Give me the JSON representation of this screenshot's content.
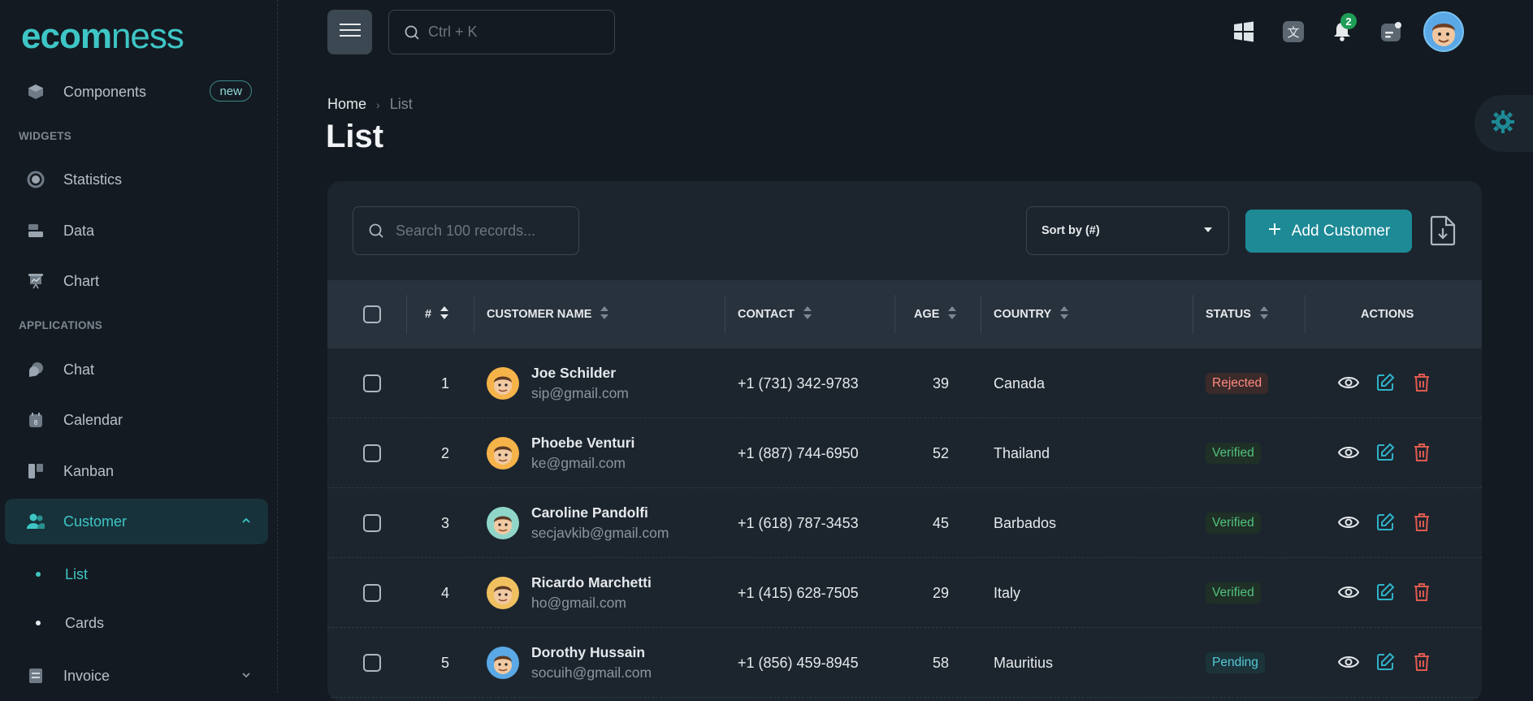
{
  "brand": {
    "logo_bold": "ecom",
    "logo_light": "ness"
  },
  "sidebar": {
    "components": {
      "label": "Components",
      "badge": "new"
    },
    "widgets_title": "WIDGETS",
    "widgets": [
      {
        "label": "Statistics",
        "icon": "statistics-icon"
      },
      {
        "label": "Data",
        "icon": "data-icon"
      },
      {
        "label": "Chart",
        "icon": "chart-icon"
      }
    ],
    "applications_title": "APPLICATIONS",
    "applications": [
      {
        "label": "Chat",
        "icon": "chat-icon"
      },
      {
        "label": "Calendar",
        "icon": "calendar-icon"
      },
      {
        "label": "Kanban",
        "icon": "kanban-icon"
      }
    ],
    "customer": {
      "label": "Customer",
      "sub": [
        "List",
        "Cards"
      ]
    },
    "invoice": {
      "label": "Invoice"
    }
  },
  "topbar": {
    "search_placeholder": "Ctrl + K",
    "notification_count": "2"
  },
  "breadcrumb": {
    "home": "Home",
    "current": "List"
  },
  "page_title": "List",
  "toolbar": {
    "search_placeholder": "Search 100 records...",
    "sort_value": "Sort by (#)",
    "add_label": "Add Customer"
  },
  "table": {
    "headers": {
      "num": "#",
      "name": "CUSTOMER NAME",
      "contact": "CONTACT",
      "age": "AGE",
      "country": "COUNTRY",
      "status": "STATUS",
      "actions": "ACTIONS"
    },
    "rows": [
      {
        "num": "1",
        "name": "Joe Schilder",
        "email": "sip@gmail.com",
        "contact": "+1 (731) 342-9783",
        "age": "39",
        "country": "Canada",
        "status": "Rejected"
      },
      {
        "num": "2",
        "name": "Phoebe Venturi",
        "email": "ke@gmail.com",
        "contact": "+1 (887) 744-6950",
        "age": "52",
        "country": "Thailand",
        "status": "Verified"
      },
      {
        "num": "3",
        "name": "Caroline Pandolfi",
        "email": "secjavkib@gmail.com",
        "contact": "+1 (618) 787-3453",
        "age": "45",
        "country": "Barbados",
        "status": "Verified"
      },
      {
        "num": "4",
        "name": "Ricardo Marchetti",
        "email": "ho@gmail.com",
        "contact": "+1 (415) 628-7505",
        "age": "29",
        "country": "Italy",
        "status": "Verified"
      },
      {
        "num": "5",
        "name": "Dorothy Hussain",
        "email": "socuih@gmail.com",
        "contact": "+1 (856) 459-8945",
        "age": "58",
        "country": "Mauritius",
        "status": "Pending"
      }
    ]
  },
  "colors": {
    "accent": "#3ec6c6",
    "primary_button": "#1d8a96",
    "rejected": "#ff8a80",
    "verified": "#52c27d",
    "pending": "#56c8d8"
  }
}
